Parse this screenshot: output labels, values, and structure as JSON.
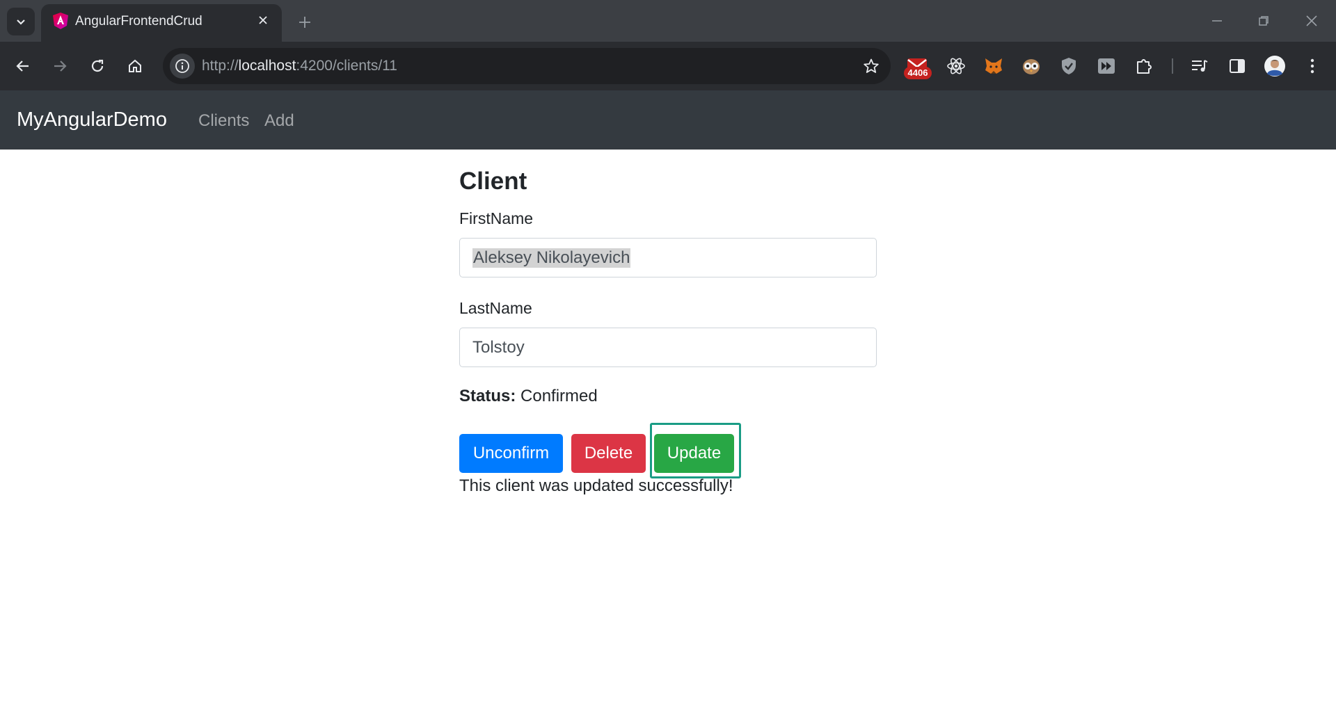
{
  "browser": {
    "tab_title": "AngularFrontendCrud",
    "url_scheme": "http://",
    "url_host": "localhost",
    "url_rest": ":4200/clients/11",
    "extension_badge": "4406",
    "icons": [
      "tab-search-icon",
      "angular-favicon-icon",
      "close-icon",
      "plus-icon",
      "minimize-icon",
      "restore-icon",
      "window-close-icon",
      "back-arrow-icon",
      "forward-arrow-icon",
      "reload-icon",
      "home-icon",
      "site-info-icon",
      "star-icon",
      "mail-extension-icon",
      "react-icon",
      "fox-extension-icon",
      "owl-extension-icon",
      "shield-icon",
      "fast-forward-icon",
      "puzzle-icon",
      "media-queue-icon",
      "side-panel-icon",
      "profile-avatar-icon",
      "kebab-menu-icon"
    ]
  },
  "navbar": {
    "brand": "MyAngularDemo",
    "links": [
      "Clients",
      "Add"
    ]
  },
  "form": {
    "title": "Client",
    "first_name_label": "FirstName",
    "first_name_value": "Aleksey Nikolayevich",
    "last_name_label": "LastName",
    "last_name_value": "Tolstoy",
    "status_label": "Status:",
    "status_value": "Confirmed",
    "buttons": {
      "unconfirm": "Unconfirm",
      "delete": "Delete",
      "update": "Update"
    },
    "message": "This client was updated successfully!"
  },
  "colors": {
    "primary": "#007bff",
    "danger": "#dc3545",
    "success": "#28a745",
    "navbar": "#343a40",
    "focus_ring": "#1a9c85"
  }
}
